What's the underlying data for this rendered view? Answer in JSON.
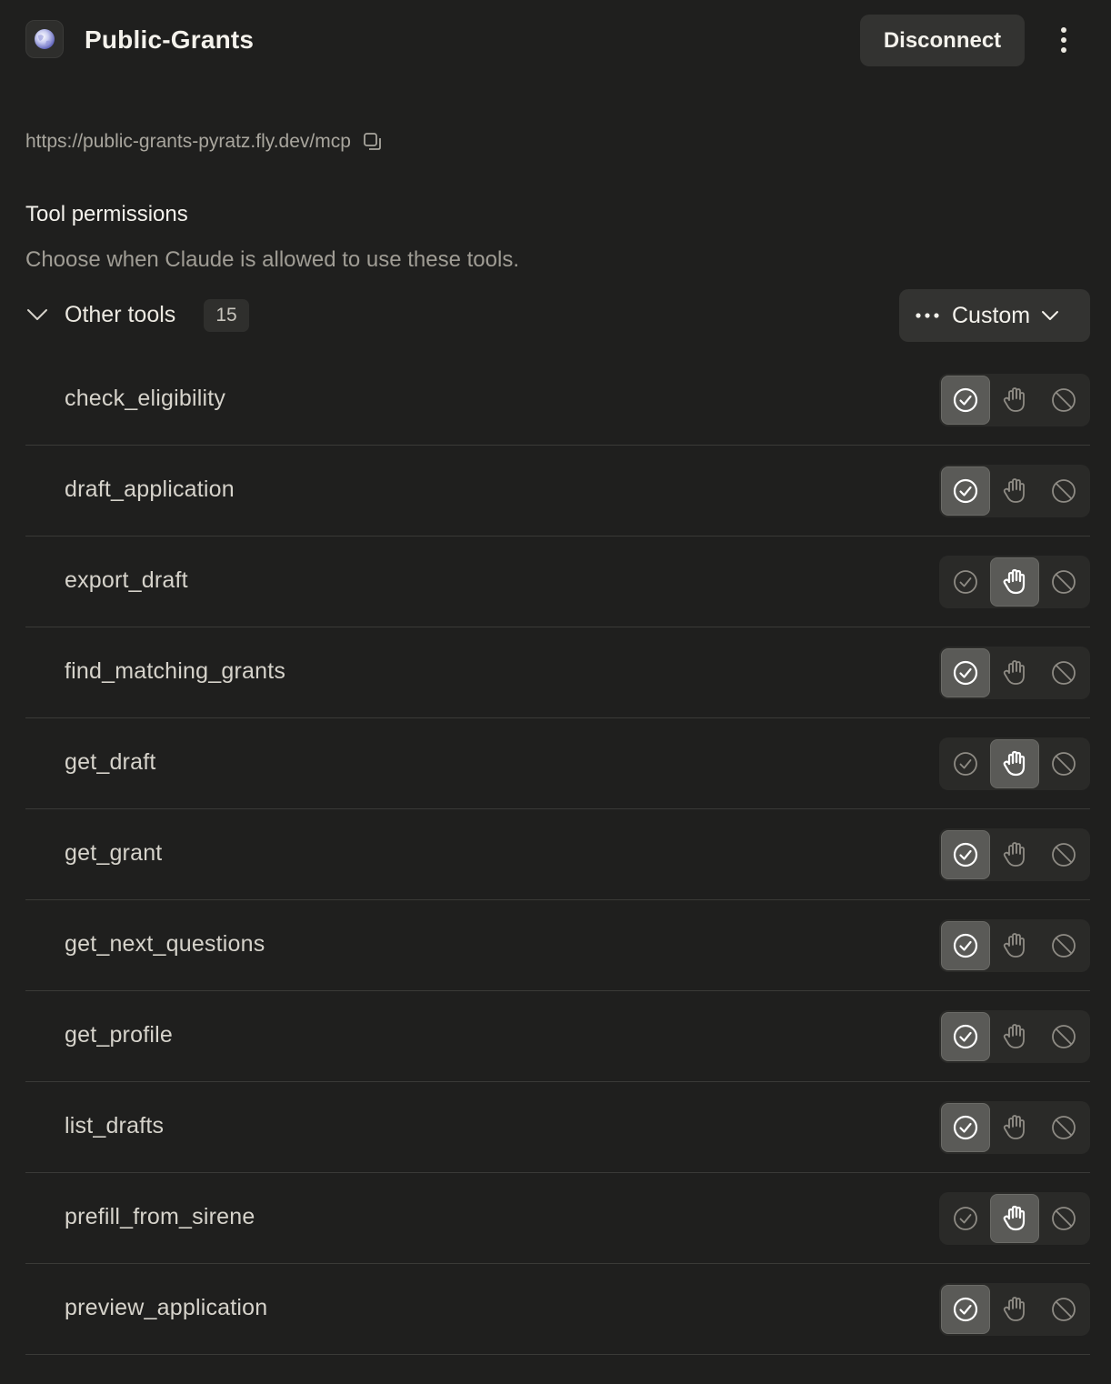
{
  "header": {
    "title": "Public-Grants",
    "disconnect_label": "Disconnect",
    "app_icon": "globe-icon",
    "more_icon": "more-vertical-icon"
  },
  "server": {
    "url": "https://public-grants-pyratz.fly.dev/mcp",
    "copy_icon": "copy-icon"
  },
  "permissions": {
    "title": "Tool permissions",
    "description": "Choose when Claude is allowed to use these tools.",
    "group": {
      "label": "Other tools",
      "count": "15",
      "mode_label": "Custom",
      "expanded": true
    }
  },
  "tools": [
    {
      "name": "check_eligibility",
      "permission": "allow"
    },
    {
      "name": "draft_application",
      "permission": "allow"
    },
    {
      "name": "export_draft",
      "permission": "ask"
    },
    {
      "name": "find_matching_grants",
      "permission": "allow"
    },
    {
      "name": "get_draft",
      "permission": "ask"
    },
    {
      "name": "get_grant",
      "permission": "allow"
    },
    {
      "name": "get_next_questions",
      "permission": "allow"
    },
    {
      "name": "get_profile",
      "permission": "allow"
    },
    {
      "name": "list_drafts",
      "permission": "allow"
    },
    {
      "name": "prefill_from_sirene",
      "permission": "ask"
    },
    {
      "name": "preview_application",
      "permission": "allow"
    }
  ],
  "icons": {
    "allow": "check-circle-icon",
    "ask": "hand-icon",
    "block": "block-icon"
  },
  "colors": {
    "background": "#1f1f1e",
    "button_bg": "#333331",
    "active_segment": "#5a5a57",
    "text_primary": "#f4f2ec",
    "text_muted": "#a09d95"
  }
}
